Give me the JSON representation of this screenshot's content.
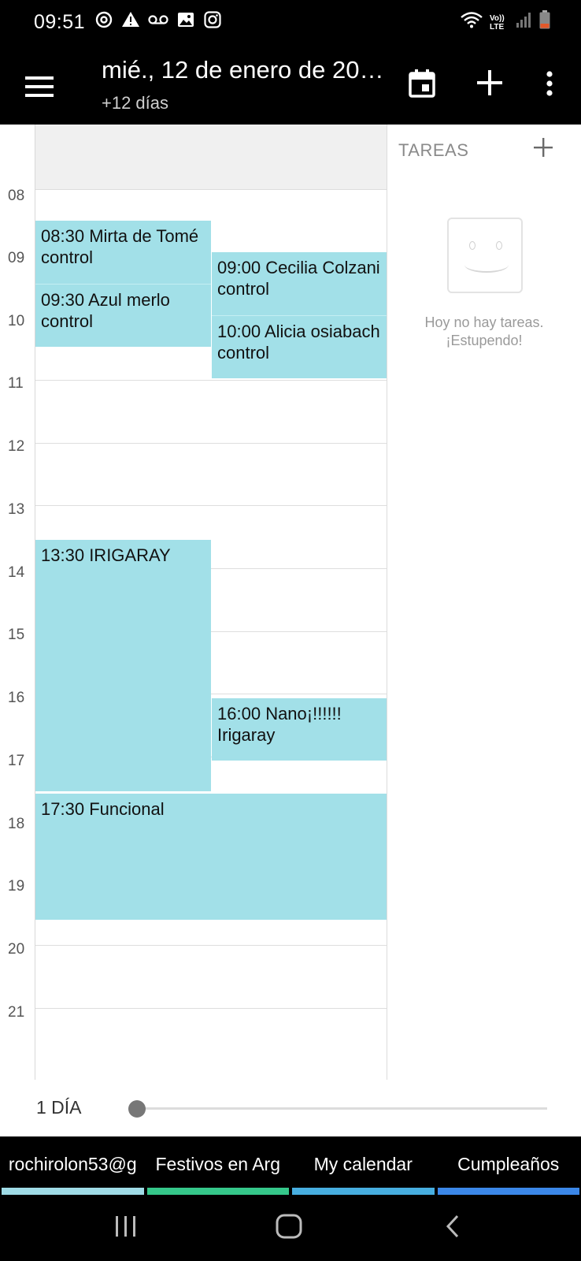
{
  "status_bar": {
    "time": "09:51",
    "left_icons": [
      "sync-icon",
      "warning-icon",
      "voicemail-icon",
      "image-icon",
      "instagram-icon"
    ],
    "right_icons": [
      "wifi-icon",
      "volte-icon",
      "signal-icon",
      "battery-icon"
    ],
    "volte_text": "Vo)) LTE"
  },
  "app_bar": {
    "title": "mié., 12 de enero de 20…",
    "subtitle": "+12 días"
  },
  "hours": [
    "08",
    "09",
    "10",
    "11",
    "12",
    "13",
    "14",
    "15",
    "16",
    "17",
    "18",
    "19",
    "20",
    "21"
  ],
  "events": [
    {
      "time": "08:30",
      "title": "Mirta de Tomé",
      "line2": "control"
    },
    {
      "time": "09:30",
      "title": "Azul merlo",
      "line2": "control"
    },
    {
      "time": "09:00",
      "title": "Cecilia Colzani",
      "line2": "control"
    },
    {
      "time": "10:00",
      "title": "Alicia osiabach",
      "line2": "control"
    },
    {
      "time": "13:30",
      "title": "IRIGARAY",
      "line2": ""
    },
    {
      "time": "16:00",
      "title": "Nano¡!!!!!!",
      "line2": "Irigaray"
    },
    {
      "time": "17:30",
      "title": "Funcional",
      "line2": ""
    }
  ],
  "tasks": {
    "title": "TAREAS",
    "empty_line1": "Hoy no hay tareas.",
    "empty_line2": "¡Estupendo!"
  },
  "zoom": {
    "label": "1 DÍA",
    "level": 0
  },
  "calendars": [
    {
      "label": "rochirolon53@g",
      "color": "#9fdbe6"
    },
    {
      "label": "Festivos en Arg",
      "color": "#35c78a"
    },
    {
      "label": "My calendar",
      "color": "#47aee0"
    },
    {
      "label": "Cumpleaños",
      "color": "#3b87e8"
    }
  ],
  "colors": {
    "event": "#a2e0e8",
    "bar": "#000000"
  }
}
